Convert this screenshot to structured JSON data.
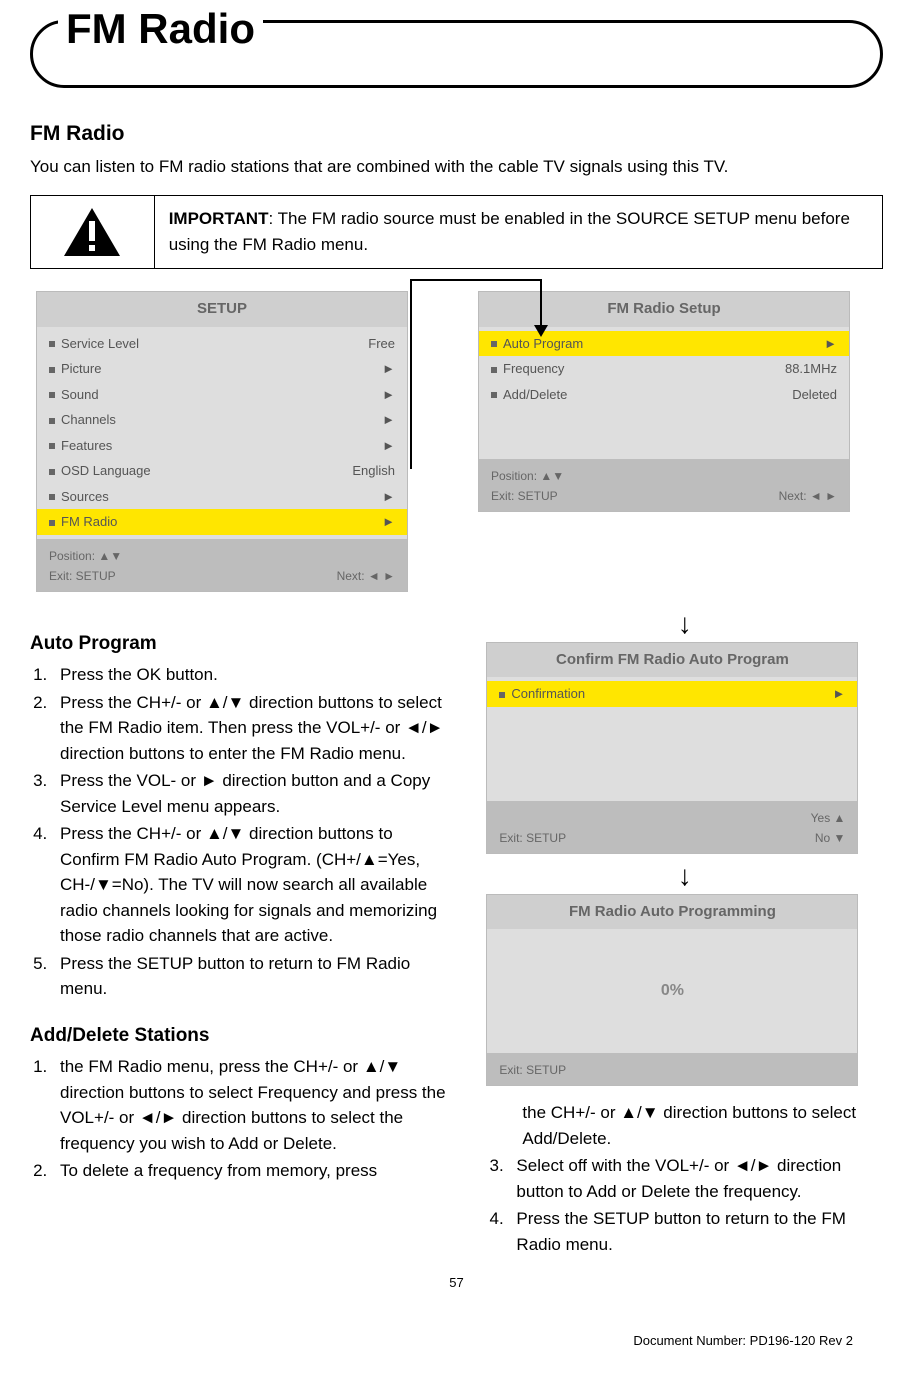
{
  "header": {
    "title": "FM Radio"
  },
  "intro": {
    "heading": "FM Radio",
    "text": "You can listen to FM radio stations that are combined with the cable TV signals using this TV."
  },
  "important": {
    "label": "IMPORTANT",
    "text": ": The FM radio source must be enabled in the SOURCE SETUP menu before using the FM Radio menu."
  },
  "screens": {
    "setup": {
      "title": "SETUP",
      "items": [
        {
          "label": "Service Level",
          "value": "Free"
        },
        {
          "label": "Picture",
          "value": "►"
        },
        {
          "label": "Sound",
          "value": "►"
        },
        {
          "label": "Channels",
          "value": "►"
        },
        {
          "label": "Features",
          "value": "►"
        },
        {
          "label": "OSD Language",
          "value": "English"
        },
        {
          "label": "Sources",
          "value": "►"
        },
        {
          "label": "FM Radio",
          "value": "►",
          "hl": true
        }
      ],
      "footer": {
        "pos": "Position: ▲▼",
        "exit": "Exit: SETUP",
        "next": "Next: ◄ ►"
      }
    },
    "fmsetup": {
      "title": "FM Radio Setup",
      "items": [
        {
          "label": "Auto Program",
          "value": "►",
          "hl": true
        },
        {
          "label": "Frequency",
          "value": "88.1MHz"
        },
        {
          "label": "Add/Delete",
          "value": "Deleted"
        }
      ],
      "footer": {
        "pos": "Position: ▲▼",
        "exit": "Exit: SETUP",
        "next": "Next: ◄ ►"
      }
    },
    "confirm": {
      "title": "Confirm FM Radio Auto Program",
      "items": [
        {
          "label": "Confirmation",
          "value": "►",
          "hl": true
        }
      ],
      "footer": {
        "exit": "Exit: SETUP",
        "yes": "Yes ▲",
        "no": "No ▼"
      }
    },
    "progress": {
      "title": "FM Radio Auto Programming",
      "value": "0%",
      "exit": "Exit: SETUP"
    }
  },
  "autoProgram": {
    "heading": "Auto Program",
    "steps": [
      "Press the OK button.",
      "Press the CH+/- or ▲/▼ direction buttons to select the FM Radio item. Then press the VOL+/- or ◄/► direction buttons to enter the FM Radio menu.",
      "Press the VOL- or ► direction button and a Copy Service Level menu appears.",
      "Press the CH+/- or ▲/▼ direction buttons to Confirm FM Radio Auto Program. (CH+/▲=Yes, CH-/▼=No). The TV will now search all available radio channels looking for signals and memorizing those radio channels that are active.",
      "Press the SETUP button to return to FM Radio menu."
    ]
  },
  "addDelete": {
    "heading": "Add/Delete Stations",
    "leftSteps": [
      "the FM Radio menu, press the CH+/- or ▲/▼ direction buttons to select Frequency and press the VOL+/- or ◄/► direction buttons to select the frequency you wish to Add or Delete.",
      "To delete a frequency from memory, press"
    ],
    "rightCont": "the CH+/- or ▲/▼ direction buttons to select Add/Delete.",
    "rightSteps": [
      "Select off with the VOL+/- or ◄/► direction button to Add or Delete the frequency.",
      "Press the SETUP button to return to the FM Radio menu."
    ]
  },
  "pageNumber": "57",
  "docNumber": "Document Number: PD196-120 Rev 2"
}
